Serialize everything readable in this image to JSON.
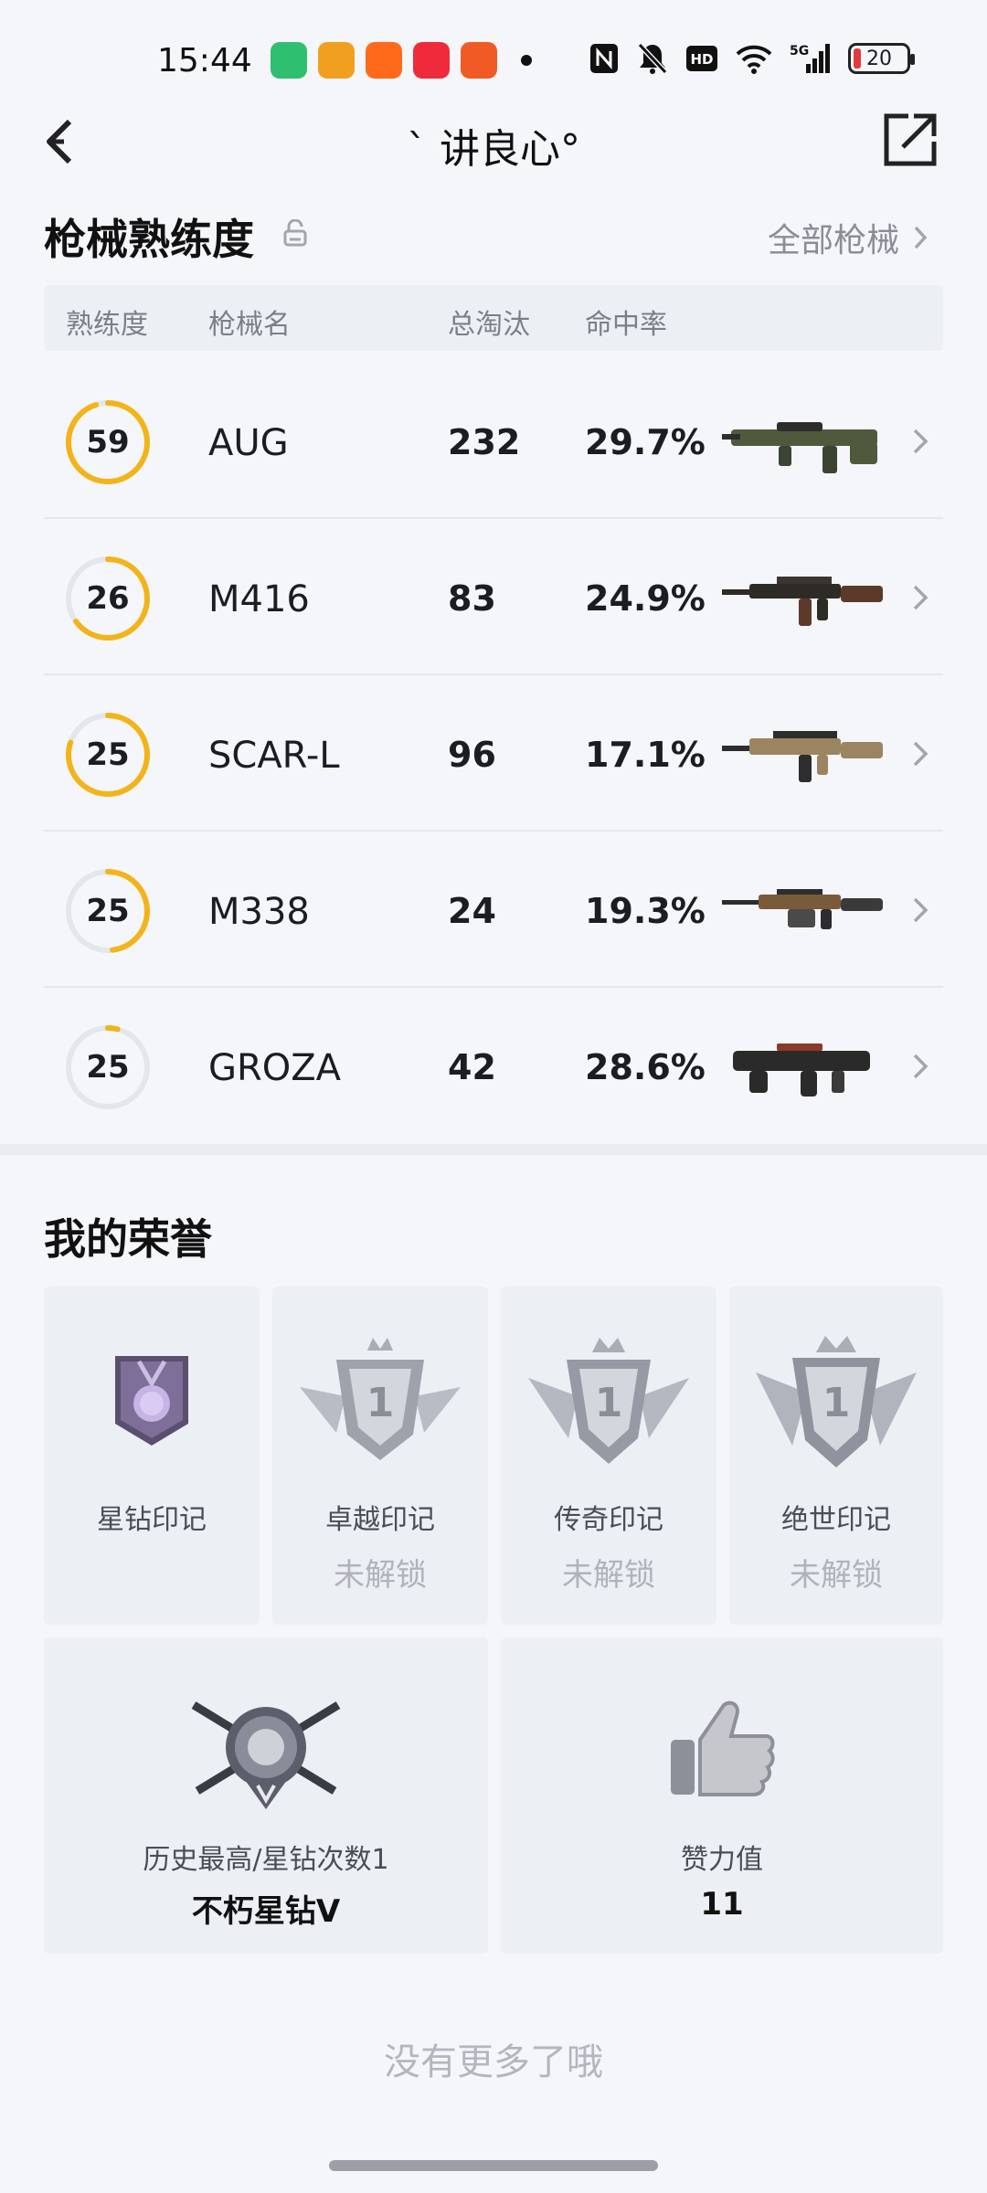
{
  "status_bar": {
    "time": "15:44",
    "network": "5G",
    "battery": "20",
    "app_colors": [
      "#2fbf71",
      "#f0a01e",
      "#ff6a1a",
      "#ef2b3b",
      "#f15a24"
    ]
  },
  "header": {
    "title": "` 讲良心°",
    "back_icon": "chevron-left-icon",
    "share_icon": "share-external-icon"
  },
  "weapons": {
    "section_title": "枪械熟练度",
    "all_label": "全部枪械",
    "columns": [
      "熟练度",
      "枪械名",
      "总淘汰",
      "命中率"
    ],
    "accent": "#f2b418",
    "rows": [
      {
        "level": "59",
        "name": "AUG",
        "kills": "232",
        "hit_rate": "29.7%",
        "progress": 0.95,
        "gun_color": "#4f5a3c"
      },
      {
        "level": "26",
        "name": "M416",
        "kills": "83",
        "hit_rate": "24.9%",
        "progress": 0.65,
        "gun_color": "#2e2a26"
      },
      {
        "level": "25",
        "name": "SCAR-L",
        "kills": "96",
        "hit_rate": "17.1%",
        "progress": 0.8,
        "gun_color": "#9b8561"
      },
      {
        "level": "25",
        "name": "M338",
        "kills": "24",
        "hit_rate": "19.3%",
        "progress": 0.48,
        "gun_color": "#7a5a3a"
      },
      {
        "level": "25",
        "name": "GROZA",
        "kills": "42",
        "hit_rate": "28.6%",
        "progress": 0.04,
        "gun_color": "#2a2a2a"
      }
    ]
  },
  "honors": {
    "section_title": "我的荣誉",
    "marks": [
      {
        "label": "星钻印记",
        "sub": ""
      },
      {
        "label": "卓越印记",
        "sub": "未解锁"
      },
      {
        "label": "传奇印记",
        "sub": "未解锁"
      },
      {
        "label": "绝世印记",
        "sub": "未解锁"
      }
    ],
    "history": {
      "label": "历史最高/星钻次数1",
      "value": "不朽星钻V"
    },
    "likes": {
      "label": "赞力值",
      "value": "11"
    }
  },
  "footer": "没有更多了哦"
}
